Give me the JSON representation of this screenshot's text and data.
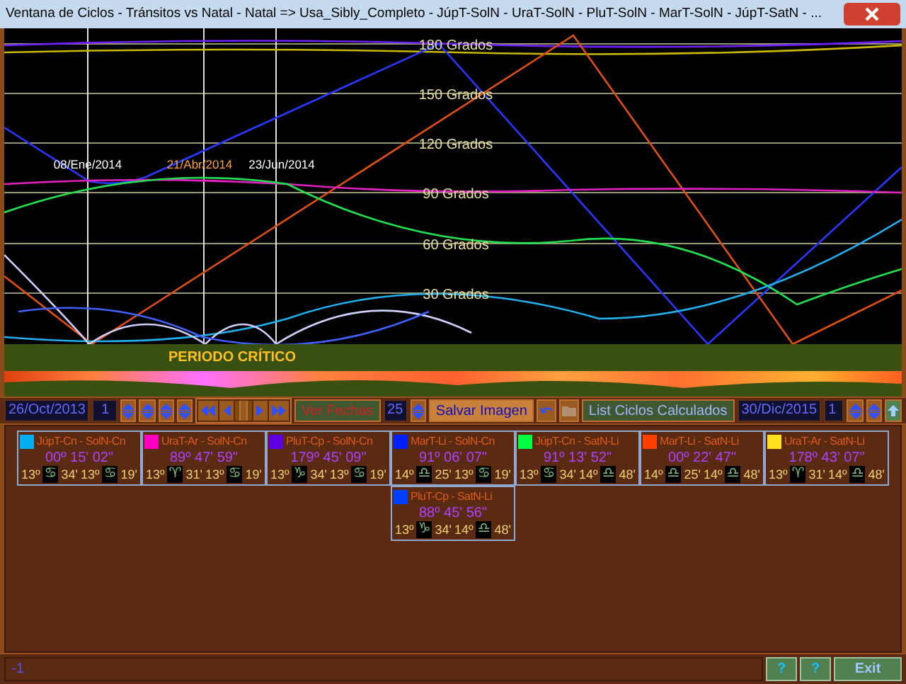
{
  "window": {
    "title": "Ventana de Ciclos - Tránsitos vs Natal - Natal => Usa_Sibly_Completo - JúpT-SolN - UraT-SolN - PluT-SolN - MarT-SolN - JúpT-SatN - ..."
  },
  "chart": {
    "grid_labels": [
      "180 Grados",
      "150 Grados",
      "120 Grados",
      "90 Grados",
      "60 Grados",
      "30 Grados"
    ],
    "markers": [
      {
        "date": "08/Ene/2014",
        "color": "#ffffff"
      },
      {
        "date": "21/Abr/2014",
        "color": "#ffa030"
      },
      {
        "date": "23/Jun/2014",
        "color": "#ffffff"
      }
    ],
    "critical_label": "PERIODO CRÍTICO"
  },
  "toolbar": {
    "start_date": "26/Oct/2013",
    "start_step": "1",
    "view_dates_button": "Ver Fechas",
    "days": "25",
    "save_button": "Salvar Imagen",
    "list_button": "List Ciclos Calculados",
    "end_date": "30/Dic/2015",
    "end_step": "1"
  },
  "cycles": [
    {
      "name": "JúpT-Cn - SolN-Cn",
      "color": "#00b0f0",
      "angle": "00º 15' 02\"",
      "transit_degree": "13º",
      "transit_sign": "♋",
      "transit_minutes": "34'",
      "natal_degree": "13º",
      "natal_sign": "♋",
      "natal_minutes": "19'"
    },
    {
      "name": "UraT-Ar - SolN-Cn",
      "color": "#ff00c0",
      "angle": "89º 47' 59\"",
      "transit_degree": "13º",
      "transit_sign": "♈",
      "transit_minutes": "31'",
      "natal_degree": "13º",
      "natal_sign": "♋",
      "natal_minutes": "19'"
    },
    {
      "name": "PluT-Cp - SolN-Cn",
      "color": "#6000e0",
      "angle": "179º 45' 09\"",
      "transit_degree": "13º",
      "transit_sign": "♑",
      "transit_minutes": "34'",
      "natal_degree": "13º",
      "natal_sign": "♋",
      "natal_minutes": "19'"
    },
    {
      "name": "MarT-Li - SolN-Cn",
      "color": "#0020ff",
      "angle": "91º 06' 07\"",
      "transit_degree": "14º",
      "transit_sign": "♎",
      "transit_minutes": "25'",
      "natal_degree": "13º",
      "natal_sign": "♋",
      "natal_minutes": "19'"
    },
    {
      "name": "JúpT-Cn - SatN-Li",
      "color": "#00ff40",
      "angle": "91º 13' 52\"",
      "transit_degree": "13º",
      "transit_sign": "♋",
      "transit_minutes": "34'",
      "natal_degree": "14º",
      "natal_sign": "♎",
      "natal_minutes": "48'"
    },
    {
      "name": "MarT-Li - SatN-Li",
      "color": "#ff4000",
      "angle": "00º 22' 47\"",
      "transit_degree": "14º",
      "transit_sign": "♎",
      "transit_minutes": "25'",
      "natal_degree": "14º",
      "natal_sign": "♎",
      "natal_minutes": "48'"
    },
    {
      "name": "UraT-Ar - SatN-Li",
      "color": "#ffe020",
      "angle": "178º 43' 07\"",
      "transit_degree": "13º",
      "transit_sign": "♈",
      "transit_minutes": "31'",
      "natal_degree": "14º",
      "natal_sign": "♎",
      "natal_minutes": "48'"
    },
    {
      "name": "PluT-Cp - SatN-Li",
      "color": "#0040ff",
      "angle": "88º 45' 56\"",
      "transit_degree": "13º",
      "transit_sign": "♑",
      "transit_minutes": "34'",
      "natal_degree": "14º",
      "natal_sign": "♎",
      "natal_minutes": "48'"
    }
  ],
  "status_bar": {
    "value": "-1",
    "buttons": [
      "?",
      "?",
      "Exit"
    ]
  }
}
